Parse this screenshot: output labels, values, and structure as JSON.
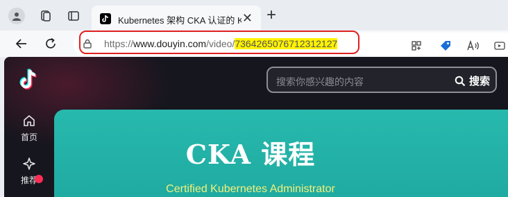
{
  "browser": {
    "tab": {
      "title": "Kubernetes 架构 CKA 认证的 Kube"
    },
    "address": {
      "scheme_prefix": "https://",
      "host": "www.douyin.com",
      "path": "/video/",
      "highlighted_id": "7364265076712312127"
    }
  },
  "page": {
    "search": {
      "placeholder": "搜索你感兴趣的内容",
      "button_label": "搜索"
    },
    "sidebar": {
      "items": [
        {
          "label": "首页",
          "icon": "home-icon"
        },
        {
          "label": "推荐",
          "icon": "sparkle-icon"
        }
      ]
    },
    "video": {
      "title": "CKA 课程",
      "subtitle": "Certified Kubernetes Administrator"
    }
  },
  "colors": {
    "highlight": "#fff200",
    "annotation": "#e02020",
    "video_bg": "#27b9ad",
    "accent": "#fe2c55"
  }
}
